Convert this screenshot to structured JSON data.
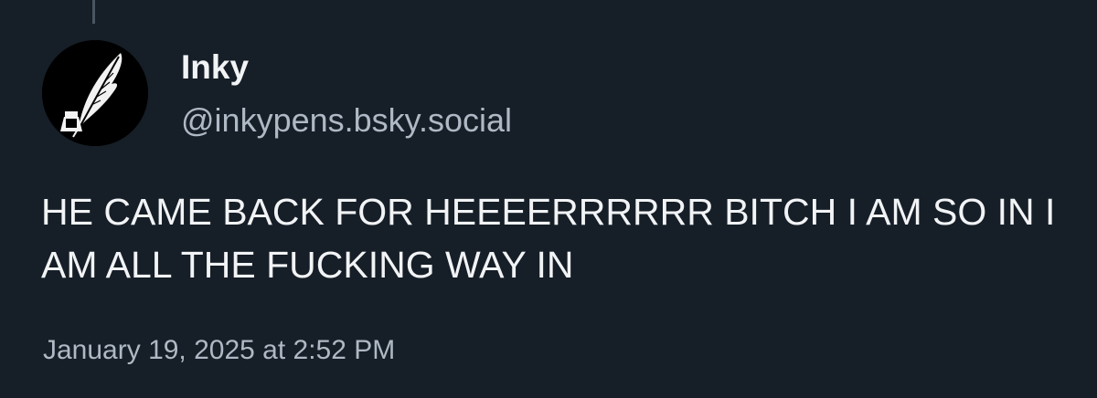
{
  "post": {
    "author": {
      "display_name": "Inky",
      "handle": "@inkypens.bsky.social",
      "avatar_icon": "quill-and-inkwell-icon"
    },
    "text": "HE CAME BACK FOR HEEEERRRRRR BITCH I AM SO IN I AM ALL THE FUCKING WAY IN",
    "timestamp": "January 19, 2025 at 2:52 PM"
  },
  "colors": {
    "background": "#161e27",
    "primary_text": "#f1f3f5",
    "secondary_text": "#aeb9c5",
    "thread_line": "#4a5562"
  }
}
